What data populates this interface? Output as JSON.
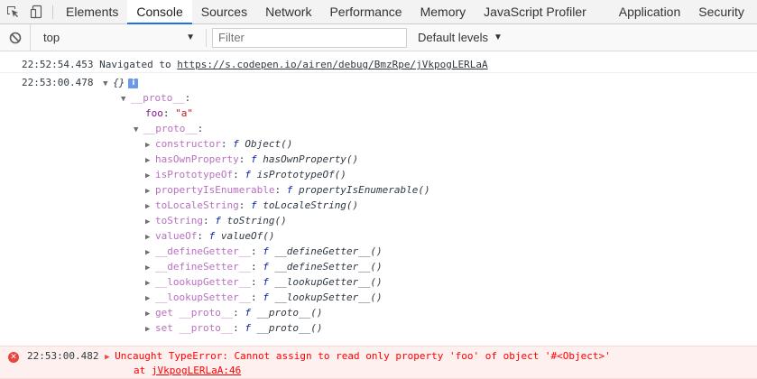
{
  "tabs": [
    {
      "label": "Elements",
      "active": false
    },
    {
      "label": "Console",
      "active": true
    },
    {
      "label": "Sources",
      "active": false
    },
    {
      "label": "Network",
      "active": false
    },
    {
      "label": "Performance",
      "active": false
    },
    {
      "label": "Memory",
      "active": false
    },
    {
      "label": "JavaScript Profiler",
      "active": false
    },
    {
      "label": "Application",
      "active": false
    },
    {
      "label": "Security",
      "active": false
    }
  ],
  "toolbar": {
    "icons": [
      "inspect-element-icon",
      "device-toolbar-icon"
    ],
    "clear_icon": "clear-console-icon",
    "context": "top",
    "filter_placeholder": "Filter",
    "levels": "Default levels",
    "accent": "#1a73e8"
  },
  "console": {
    "nav": {
      "time": "22:52:54.453",
      "text": "Navigated to",
      "url": "https://s.codepen.io/airen/debug/BmzRpe/jVkpogLERLaA"
    },
    "obj": {
      "time": "22:53:00.478",
      "summary": "{}",
      "info": "i",
      "proto_label": "__proto__",
      "foo_key": "foo",
      "foo_value": "\"a\"",
      "inner_proto_label": "__proto__",
      "members": [
        {
          "key": "constructor",
          "f": "f",
          "name": "Object()"
        },
        {
          "key": "hasOwnProperty",
          "f": "f",
          "name": "hasOwnProperty()"
        },
        {
          "key": "isPrototypeOf",
          "f": "f",
          "name": "isPrototypeOf()"
        },
        {
          "key": "propertyIsEnumerable",
          "f": "f",
          "name": "propertyIsEnumerable()"
        },
        {
          "key": "toLocaleString",
          "f": "f",
          "name": "toLocaleString()"
        },
        {
          "key": "toString",
          "f": "f",
          "name": "toString()"
        },
        {
          "key": "valueOf",
          "f": "f",
          "name": "valueOf()"
        },
        {
          "key": "__defineGetter__",
          "f": "f",
          "name": "__defineGetter__()"
        },
        {
          "key": "__defineSetter__",
          "f": "f",
          "name": "__defineSetter__()"
        },
        {
          "key": "__lookupGetter__",
          "f": "f",
          "name": "__lookupGetter__()"
        },
        {
          "key": "__lookupSetter__",
          "f": "f",
          "name": "__lookupSetter__()"
        },
        {
          "key": "get __proto__",
          "f": "f",
          "name": "__proto__()"
        },
        {
          "key": "set __proto__",
          "f": "f",
          "name": "__proto__()"
        }
      ]
    },
    "error": {
      "time": "22:53:00.482",
      "message": "Uncaught TypeError: Cannot assign to read only property 'foo' of object '#<Object>'",
      "at": "at",
      "location": "jVkpogLERLaA:46",
      "color": "#ff0000"
    }
  }
}
